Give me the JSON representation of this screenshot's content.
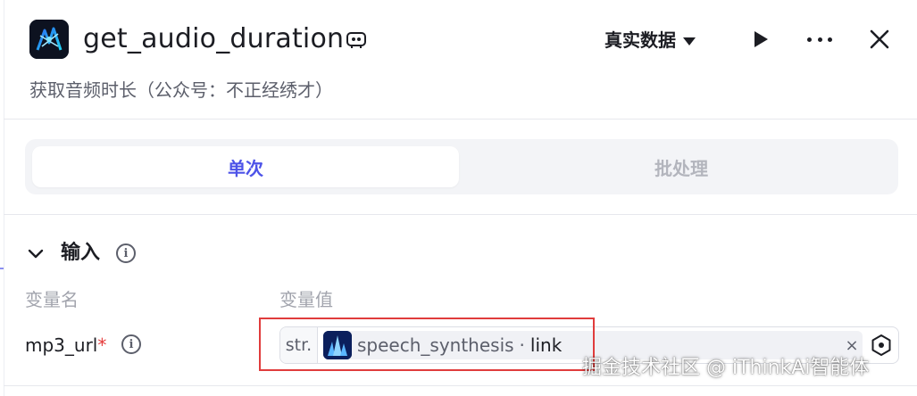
{
  "header": {
    "app_icon": "audio-duration-plugin-icon",
    "title": "get_audio_duration",
    "title_icon": "coze-plugin-icon",
    "mode_select": {
      "label": "真实数据",
      "icon": "caret-down-icon"
    },
    "run_icon": "play-icon",
    "more_icon": "more-dots-icon",
    "close_icon": "close-icon",
    "subtitle": "获取音频时长（公众号：不正经绣才）"
  },
  "tabs": [
    {
      "label": "单次",
      "active": true
    },
    {
      "label": "批处理",
      "active": false
    }
  ],
  "input_section": {
    "title": "输入",
    "toggle_icon": "chevron-down-icon",
    "info_icon": "info-icon",
    "columns": {
      "name": "变量名",
      "value": "变量值"
    },
    "rows": [
      {
        "name": "mp3_url",
        "required_mark": "*",
        "type_tag": "str.",
        "reference": {
          "node_icon": "speech-synthesis-node-icon",
          "node": "speech_synthesis",
          "separator": "·",
          "field": "link"
        },
        "clear_label": "×",
        "picker_icon": "variable-picker-icon"
      }
    ]
  },
  "watermark": "掘金技术社区 @ iThinkAi智能体",
  "colors": {
    "accent": "#4d53e8",
    "highlight": "#e03c3c",
    "required": "#e53a3a"
  }
}
